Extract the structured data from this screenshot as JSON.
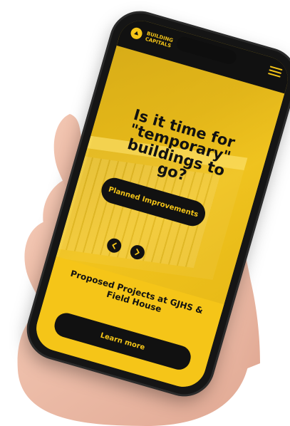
{
  "brand": {
    "logo_text_line1": "BUILDING",
    "logo_text_line2": "CAPITALS",
    "accent_color": "#f5c518"
  },
  "hero": {
    "title": "Is it time for \"temporary\" buildings to go?",
    "cta_label": "Planned Improvements"
  },
  "bottom": {
    "title": "Proposed Projects at GJHS & Field House",
    "cta_label": "Learn more"
  },
  "icons": {
    "prev": "arrow-left-icon",
    "next": "arrow-right-icon",
    "menu": "hamburger-icon"
  }
}
